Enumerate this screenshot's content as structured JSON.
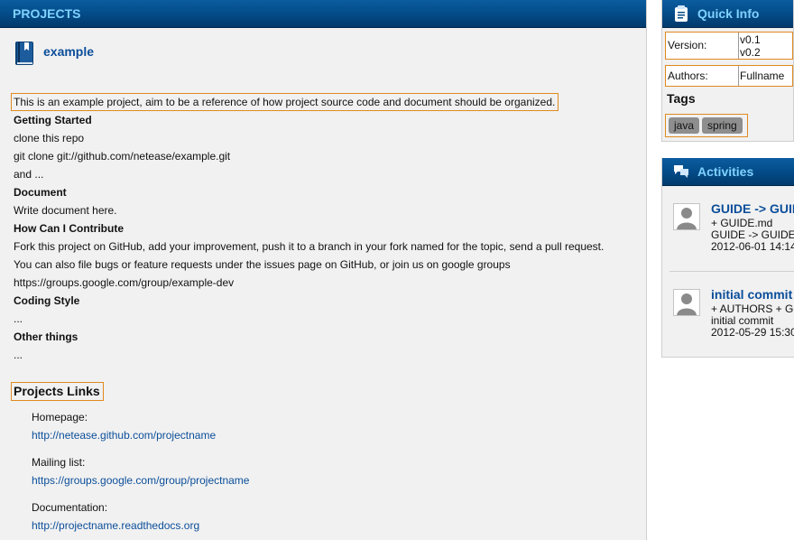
{
  "main": {
    "header": "PROJECTS",
    "project_name": "example",
    "intro": "This is an example project, aim to be a reference of how project source code and document should be organized.",
    "readme": [
      {
        "text": "Getting Started",
        "bold": true
      },
      {
        "text": "clone this repo",
        "bold": false
      },
      {
        "text": "git clone git://github.com/netease/example.git",
        "bold": false
      },
      {
        "text": "and ...",
        "bold": false
      },
      {
        "text": "Document",
        "bold": true
      },
      {
        "text": "Write document here.",
        "bold": false
      },
      {
        "text": "How Can I Contribute",
        "bold": true
      },
      {
        "text": "Fork this project on GitHub, add your improvement, push it to a branch in your fork named for the topic, send a pull request.",
        "bold": false
      },
      {
        "text": "You can also file bugs or feature requests under the issues page on GitHub, or join us on google groups",
        "bold": false
      },
      {
        "text": "https://groups.google.com/group/example-dev",
        "bold": false
      },
      {
        "text": "Coding Style",
        "bold": true
      },
      {
        "text": "...",
        "bold": false
      },
      {
        "text": "Other things",
        "bold": true
      },
      {
        "text": "...",
        "bold": false
      }
    ],
    "links_title": "Projects Links",
    "links": [
      {
        "label": "Homepage:",
        "url": "http://netease.github.com/projectname"
      },
      {
        "label": "Mailing list:",
        "url": "https://groups.google.com/group/projectname"
      },
      {
        "label": "Documentation:",
        "url": "http://projectname.readthedocs.org"
      }
    ]
  },
  "sidebar": {
    "quick_info": {
      "title": "Quick Info",
      "icon": "clipboard-icon",
      "version_label": "Version:",
      "versions": [
        "v0.1",
        "v0.2"
      ],
      "authors_label": "Authors:",
      "authors_value": "Fullname",
      "tags_title": "Tags",
      "tags": [
        "java",
        "spring"
      ]
    },
    "activities": {
      "title": "Activities",
      "icon": "chat-bubbles-icon",
      "items": [
        {
          "title": "GUIDE -> GUIDE.md",
          "lines": [
            "+ GUIDE.md",
            "GUIDE -> GUIDE.md"
          ],
          "date": "2012-06-01 14:14"
        },
        {
          "title": "initial commit",
          "lines": [
            "+ AUTHORS + GUIDE",
            "initial commit"
          ],
          "date": "2012-05-29 15:30"
        }
      ]
    }
  },
  "colors": {
    "header_text": "#7fd2ff",
    "header_bg": "#034a86",
    "link": "#0b4e9a",
    "highlight_border": "#e08a20",
    "panel_bg": "#f1f1f1",
    "tag_bg": "#8e8e8e"
  }
}
